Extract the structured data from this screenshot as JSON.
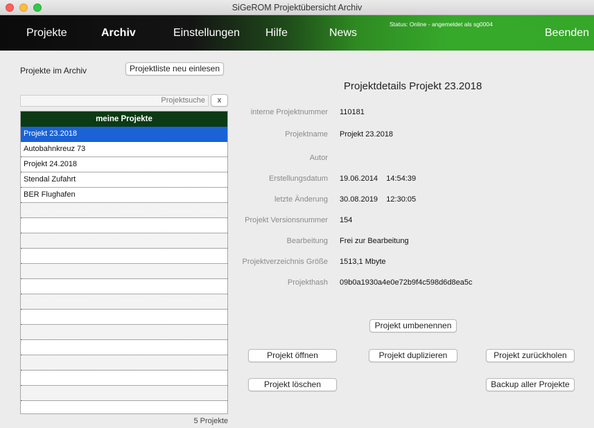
{
  "window": {
    "title": "SiGeROM  Projektübersicht Archiv"
  },
  "nav": {
    "items": [
      "Projekte",
      "Archiv",
      "Einstellungen",
      "Hilfe",
      "News"
    ],
    "active": "Archiv",
    "status": "Status: Online - angemeldet als sg0004",
    "quit": "Beenden"
  },
  "archive": {
    "title": "Projekte im Archiv",
    "reload_button": "Projektliste neu einlesen",
    "search_placeholder": "Projektsuche",
    "search_clear": "x",
    "list_header": "meine Projekte",
    "projects": [
      "Projekt 23.2018",
      "Autobahnkreuz 73",
      "Projekt 24.2018",
      "Stendal Zufahrt",
      "BER Flughafen"
    ],
    "selected_index": 0,
    "count_label": "5 Projekte"
  },
  "details": {
    "heading": "Projektdetails Projekt 23.2018",
    "fields": [
      {
        "label": "interne Projektnummer",
        "value": "110181"
      },
      {
        "label": "Projektname",
        "value": "Projekt 23.2018"
      },
      {
        "label": "Autor",
        "value": ""
      },
      {
        "label": "Erstellungsdatum",
        "value": "19.06.2014    14:54:39"
      },
      {
        "label": "letzte Änderung",
        "value": "30.08.2019    12:30:05"
      },
      {
        "label": "Projekt Versionsnummer",
        "value": "154"
      },
      {
        "label": "Bearbeitung",
        "value": "Frei zur Bearbeitung"
      },
      {
        "label": "Projektverzeichnis Größe",
        "value": "1513,1 Mbyte"
      },
      {
        "label": "Projekthash",
        "value": "09b0a1930a4e0e72b9f4c598d6d8ea5c"
      }
    ]
  },
  "actions": {
    "rename": "Projekt umbenennen",
    "open": "Projekt öffnen",
    "duplicate": "Projekt duplizieren",
    "restore": "Projekt zurückholen",
    "delete": "Projekt löschen",
    "backup": "Backup aller Projekte"
  },
  "colors": {
    "selection": "#1a62d6",
    "list_header": "#0b3a14",
    "nav_accent": "#36a82a"
  }
}
